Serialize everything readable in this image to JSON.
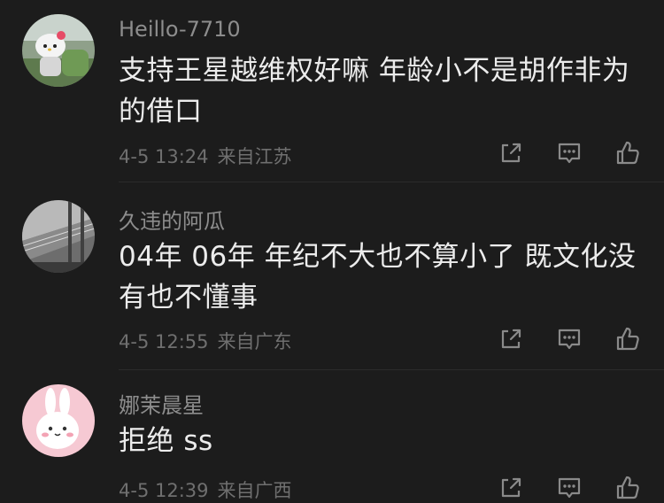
{
  "comments": [
    {
      "username": "Heillo-7710",
      "text": "支持王星越维权好嘛 年龄小不是胡作非为的借口",
      "date": "4-5 13:24",
      "location": "来自江苏",
      "avatar_icon": "hello-kitty-avatar"
    },
    {
      "username": "久违的阿瓜",
      "text": "04年 06年 年纪不大也不算小了 既文化没有也不懂事",
      "date": "4-5 12:55",
      "location": "来自广东",
      "avatar_icon": "building-photo-avatar"
    },
    {
      "username": "娜茉晨星",
      "text": "拒绝 ss",
      "date": "4-5 12:39",
      "location": "来自广西",
      "avatar_icon": "rabbit-avatar"
    }
  ],
  "icons": {
    "share": "share-icon",
    "reply": "comment-icon",
    "like": "thumbs-up-icon"
  },
  "colors": {
    "background": "#1c1c1c",
    "text": "#ececec",
    "username": "#8d8d8d",
    "meta": "#6f6f6f"
  }
}
